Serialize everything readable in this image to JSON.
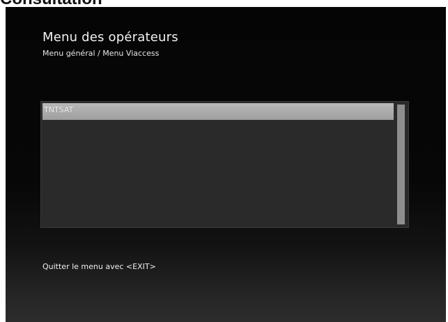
{
  "document": {
    "heading": "Consultation"
  },
  "screen": {
    "title": "Menu des opérateurs",
    "breadcrumb": "Menu général / Menu Viaccess",
    "operators": [
      {
        "label": "TNTSAT",
        "selected": true
      }
    ],
    "footer_hint": "Quitter le menu avec <EXIT>"
  },
  "colors": {
    "background": "#050505",
    "panel": "#2a2a2a",
    "selection": "#aaaaaa",
    "scrollbar": "#8e8e8e",
    "text": "#f2f2f2"
  }
}
